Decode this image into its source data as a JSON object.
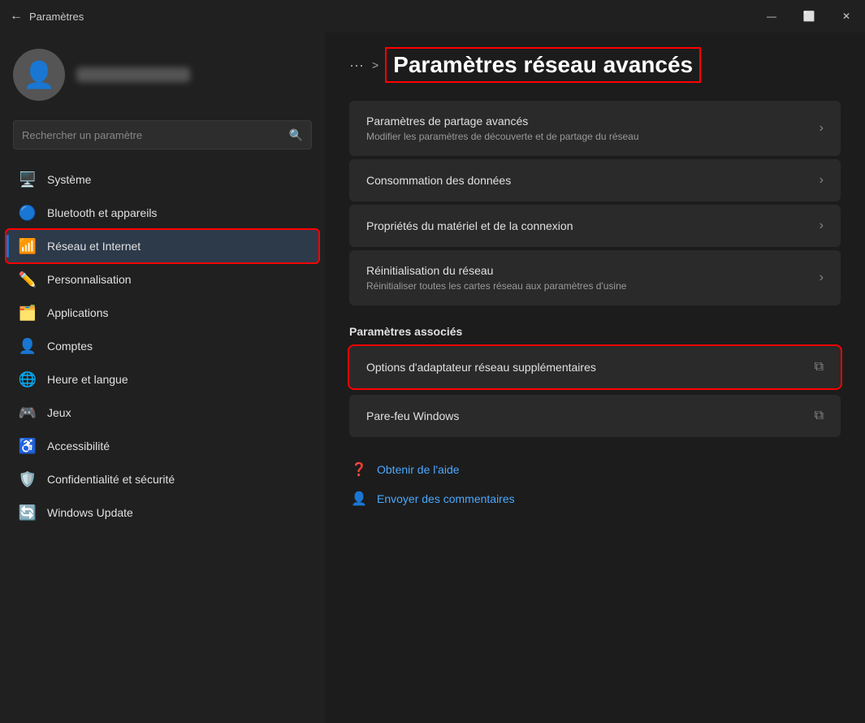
{
  "titlebar": {
    "back_icon": "←",
    "title": "Paramètres",
    "minimize_label": "—",
    "restore_label": "⬜",
    "close_label": "✕"
  },
  "sidebar": {
    "search_placeholder": "Rechercher un paramètre",
    "nav_items": [
      {
        "id": "systeme",
        "label": "Système",
        "icon": "🖥️",
        "active": false
      },
      {
        "id": "bluetooth",
        "label": "Bluetooth et appareils",
        "icon": "🔵",
        "active": false
      },
      {
        "id": "reseau",
        "label": "Réseau et Internet",
        "icon": "📶",
        "active": true,
        "outlined": true
      },
      {
        "id": "personnalisation",
        "label": "Personnalisation",
        "icon": "✏️",
        "active": false
      },
      {
        "id": "applications",
        "label": "Applications",
        "icon": "🗂️",
        "active": false
      },
      {
        "id": "comptes",
        "label": "Comptes",
        "icon": "👤",
        "active": false
      },
      {
        "id": "heure",
        "label": "Heure et langue",
        "icon": "🌐",
        "active": false
      },
      {
        "id": "jeux",
        "label": "Jeux",
        "icon": "🎮",
        "active": false
      },
      {
        "id": "accessibilite",
        "label": "Accessibilité",
        "icon": "♿",
        "active": false
      },
      {
        "id": "confidentialite",
        "label": "Confidentialité et sécurité",
        "icon": "🛡️",
        "active": false
      },
      {
        "id": "windows-update",
        "label": "Windows Update",
        "icon": "🔄",
        "active": false
      }
    ]
  },
  "content": {
    "breadcrumb_dots": "···",
    "breadcrumb_arrow": ">",
    "page_title": "Paramètres réseau avancés",
    "settings_items": [
      {
        "id": "partage",
        "title": "Paramètres de partage avancés",
        "desc": "Modifier les paramètres de découverte et de partage du réseau",
        "type": "chevron",
        "outlined": false
      },
      {
        "id": "consommation",
        "title": "Consommation des données",
        "desc": "",
        "type": "chevron",
        "outlined": false
      },
      {
        "id": "proprietes",
        "title": "Propriétés du matériel et de la connexion",
        "desc": "",
        "type": "chevron",
        "outlined": false
      },
      {
        "id": "reinitialisation",
        "title": "Réinitialisation du réseau",
        "desc": "Réinitialiser toutes les cartes réseau aux paramètres d'usine",
        "type": "chevron",
        "outlined": false
      }
    ],
    "section_associes": "Paramètres associés",
    "associes_items": [
      {
        "id": "adaptateur",
        "title": "Options d'adaptateur réseau supplémentaires",
        "desc": "",
        "type": "external",
        "outlined": true
      },
      {
        "id": "parefeu",
        "title": "Pare-feu Windows",
        "desc": "",
        "type": "external",
        "outlined": false
      }
    ],
    "help_links": [
      {
        "id": "aide",
        "text": "Obtenir de l'aide",
        "icon": "❓"
      },
      {
        "id": "commentaires",
        "text": "Envoyer des commentaires",
        "icon": "👤"
      }
    ]
  }
}
